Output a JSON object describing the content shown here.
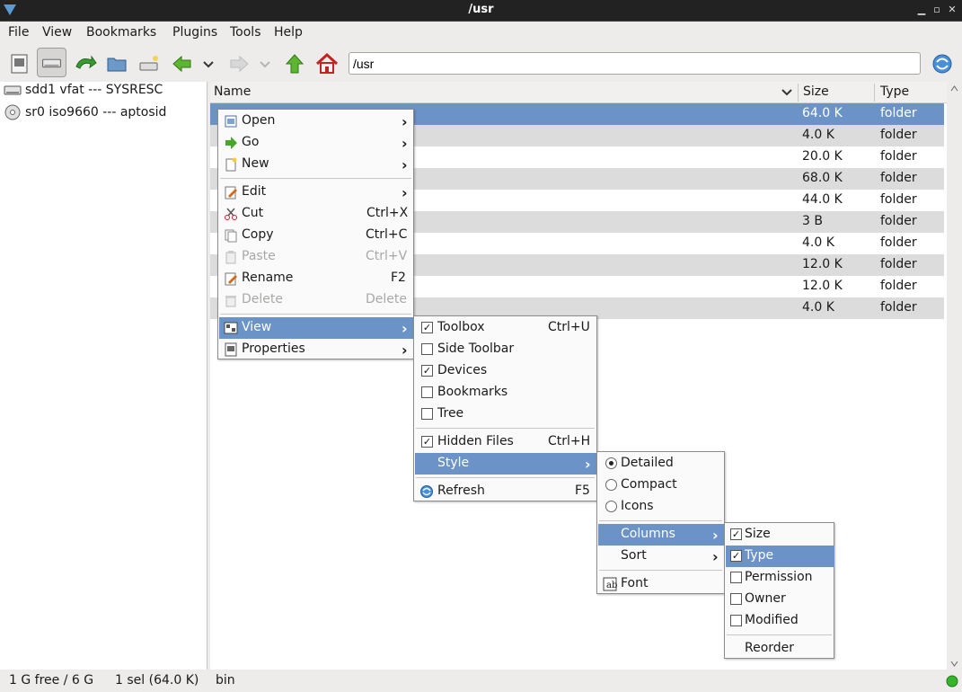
{
  "window": {
    "title": "/usr",
    "controls": [
      "▁",
      "▫",
      "✕"
    ]
  },
  "menubar": [
    "File",
    "View",
    "Bookmarks",
    "Plugins",
    "Tools",
    "Help"
  ],
  "address": {
    "value": "/usr"
  },
  "devices": [
    {
      "label": "sdd1 vfat --- SYSRESC",
      "icon": "drive-icon"
    },
    {
      "label": "sr0 iso9660 --- aptosid",
      "icon": "cdrom-icon"
    }
  ],
  "list": {
    "headers": {
      "name": "Name",
      "size": "Size",
      "type": "Type"
    },
    "rows": [
      {
        "size": "64.0 K",
        "type": "folder"
      },
      {
        "size": "4.0 K",
        "type": "folder"
      },
      {
        "size": "20.0 K",
        "type": "folder"
      },
      {
        "size": "68.0 K",
        "type": "folder"
      },
      {
        "size": "44.0 K",
        "type": "folder"
      },
      {
        "size": "3 B",
        "type": "folder"
      },
      {
        "size": "4.0 K",
        "type": "folder"
      },
      {
        "size": "12.0 K",
        "type": "folder"
      },
      {
        "size": "12.0 K",
        "type": "folder"
      },
      {
        "size": "4.0 K",
        "type": "folder"
      }
    ]
  },
  "context_menu": {
    "open": "Open",
    "go": "Go",
    "new": "New",
    "edit": "Edit",
    "cut": "Cut",
    "cut_sc": "Ctrl+X",
    "copy": "Copy",
    "copy_sc": "Ctrl+C",
    "paste": "Paste",
    "paste_sc": "Ctrl+V",
    "rename": "Rename",
    "rename_sc": "F2",
    "delete": "Delete",
    "delete_sc": "Delete",
    "view": "View",
    "properties": "Properties"
  },
  "view_menu": {
    "toolbox": "Toolbox",
    "toolbox_sc": "Ctrl+U",
    "toolbox_checked": true,
    "side_toolbar": "Side Toolbar",
    "side_toolbar_checked": false,
    "devices": "Devices",
    "devices_checked": true,
    "bookmarks": "Bookmarks",
    "bookmarks_checked": false,
    "tree": "Tree",
    "tree_checked": false,
    "hidden_files": "Hidden Files",
    "hidden_files_sc": "Ctrl+H",
    "hidden_files_checked": true,
    "style": "Style",
    "refresh": "Refresh",
    "refresh_sc": "F5"
  },
  "style_menu": {
    "detailed": "Detailed",
    "compact": "Compact",
    "icons": "Icons",
    "selected": "Detailed",
    "columns": "Columns",
    "sort": "Sort",
    "font": "Font"
  },
  "columns_menu": {
    "size": "Size",
    "size_checked": true,
    "type": "Type",
    "type_checked": true,
    "permission": "Permission",
    "permission_checked": false,
    "owner": "Owner",
    "owner_checked": false,
    "modified": "Modified",
    "modified_checked": false,
    "reorder": "Reorder"
  },
  "status": {
    "free": "1 G free / 6 G",
    "selection": "1 sel (64.0 K)",
    "name": "bin"
  },
  "colors": {
    "highlight": "#6b93c7",
    "titlebar": "#222222",
    "window_bg": "#edeceb",
    "row_alt": "#dcdcdc",
    "status_ok": "#35b52a"
  }
}
